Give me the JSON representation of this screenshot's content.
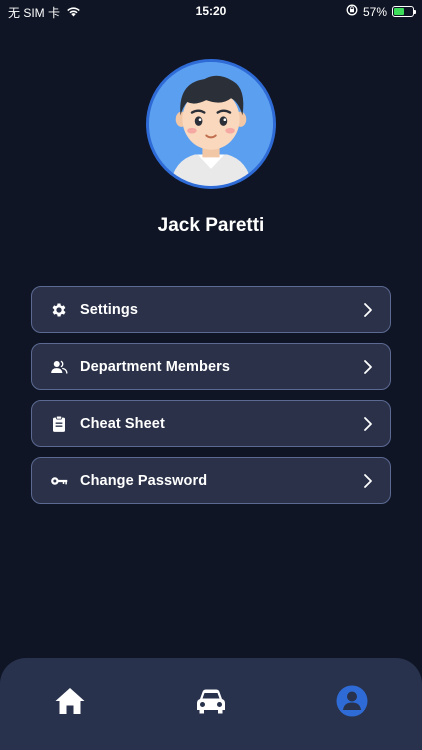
{
  "status_bar": {
    "carrier": "无 SIM 卡",
    "time": "15:20",
    "battery_percent": "57%",
    "battery_level": 0.57,
    "icons": [
      "wifi-icon",
      "lock-rotation-icon",
      "battery-icon"
    ]
  },
  "profile": {
    "name": "Jack Paretti",
    "avatar": "avatar-illustration"
  },
  "menu": {
    "items": [
      {
        "label": "Settings",
        "icon": "gear-icon"
      },
      {
        "label": "Department Members",
        "icon": "users-icon"
      },
      {
        "label": "Cheat Sheet",
        "icon": "clipboard-icon"
      },
      {
        "label": "Change Password",
        "icon": "key-icon"
      }
    ]
  },
  "tab_bar": {
    "tabs": [
      {
        "name": "home",
        "icon": "home-icon",
        "active": false
      },
      {
        "name": "car",
        "icon": "car-icon",
        "active": false
      },
      {
        "name": "profile",
        "icon": "profile-icon",
        "active": true
      }
    ]
  },
  "colors": {
    "background": "#0f1524",
    "card_background": "#2a3148",
    "card_border": "#5c6a93",
    "tab_bar": "#28324d",
    "tab_icon": "#ffffff",
    "tab_icon_active": "#2f6bd6",
    "avatar_bg": "#5b9ff0"
  }
}
